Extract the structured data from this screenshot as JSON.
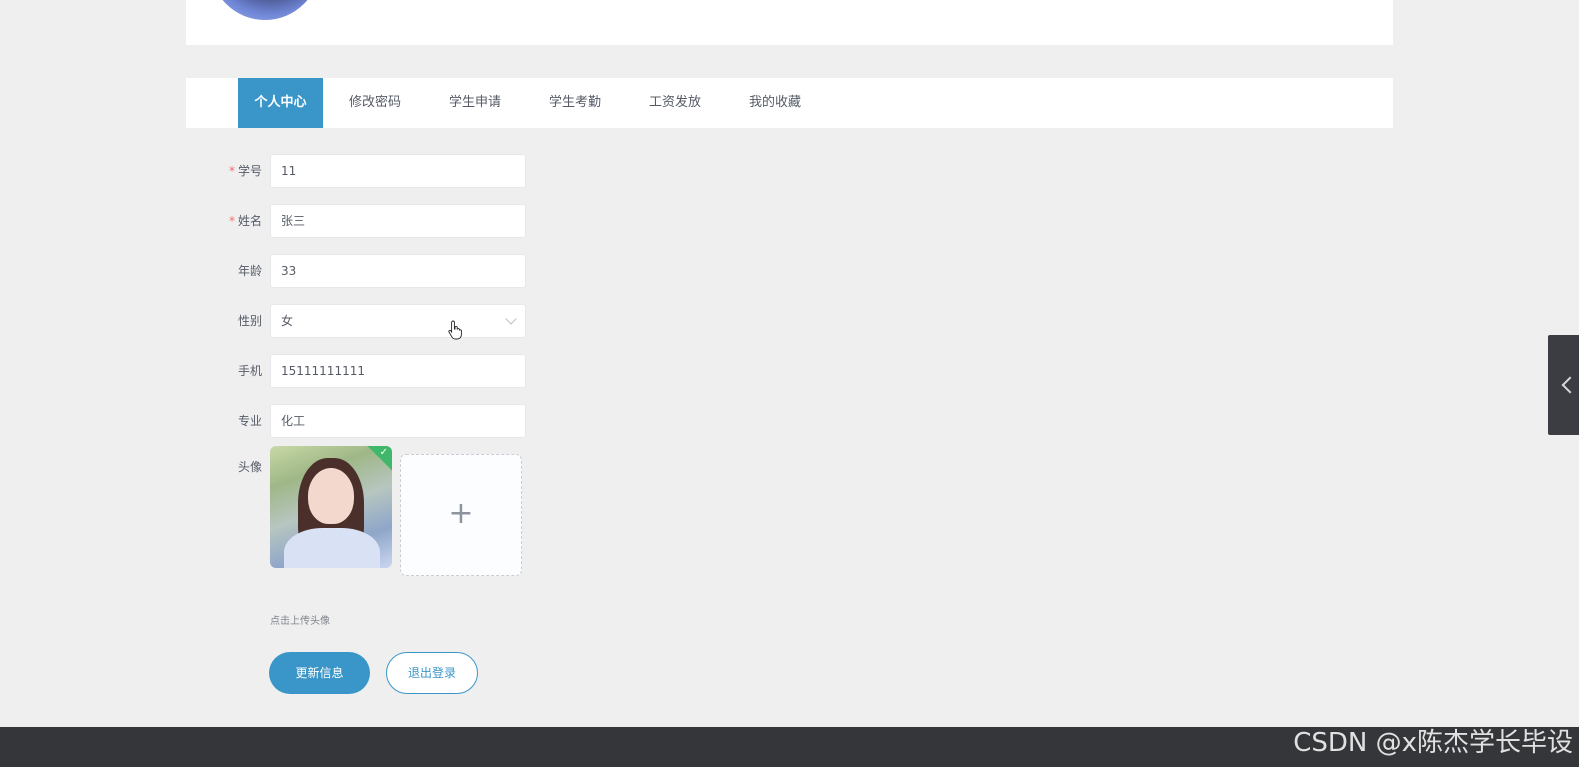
{
  "tabs": [
    {
      "label": "个人中心",
      "active": true
    },
    {
      "label": "修改密码",
      "active": false
    },
    {
      "label": "学生申请",
      "active": false
    },
    {
      "label": "学生考勤",
      "active": false
    },
    {
      "label": "工资发放",
      "active": false
    },
    {
      "label": "我的收藏",
      "active": false
    }
  ],
  "form": {
    "student_id": {
      "label": "学号",
      "required": true,
      "value": "11"
    },
    "name": {
      "label": "姓名",
      "required": true,
      "value": "张三"
    },
    "age": {
      "label": "年龄",
      "required": false,
      "value": "33"
    },
    "gender": {
      "label": "性别",
      "required": false,
      "value": "女"
    },
    "phone": {
      "label": "手机",
      "required": false,
      "value": "15111111111"
    },
    "major": {
      "label": "专业",
      "required": false,
      "value": "化工"
    },
    "avatar": {
      "label": "头像",
      "upload_tip": "点击上传头像"
    }
  },
  "required_mark": "*",
  "upload_plus": "+",
  "buttons": {
    "update": "更新信息",
    "logout": "退出登录"
  },
  "watermark": "CSDN @x陈杰学长毕设",
  "colors": {
    "accent": "#3a96c9",
    "required": "#f56c6c",
    "footer": "#35363a",
    "background": "#efeff0"
  },
  "icons": {
    "upload": "plus-icon",
    "select": "chevron-down-icon",
    "side_toggle": "chevron-left-icon",
    "uploaded": "check-icon",
    "cursor": "hand-pointer-icon"
  }
}
